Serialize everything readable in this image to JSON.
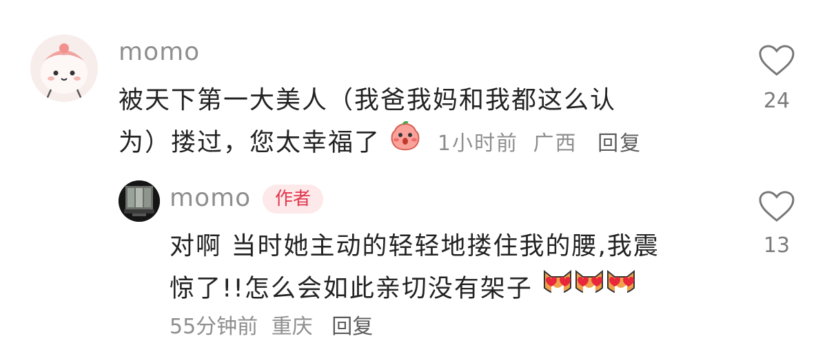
{
  "comment": {
    "username": "momo",
    "text_line1": "被天下第一大美人（我爸我妈和我都这么认",
    "text_line2": "为）搂过，您太幸福了",
    "time": "1小时前",
    "location": "广西",
    "reply_label": "回复",
    "like_count": "24"
  },
  "reply": {
    "username": "momo",
    "badge": "作者",
    "text_line1": "对啊 当时她主动的轻轻地搂住我的腰,我震",
    "text_line2": "惊了!!怎么会如此亲切没有架子",
    "time": "55分钟前",
    "location": "重庆",
    "reply_label": "回复",
    "like_count": "13"
  },
  "icons": {
    "like": "heart-outline-icon",
    "emoji_comment": "blushing-peach-emoji",
    "emoji_reply": "heart-eyes-dog-emoji"
  },
  "colors": {
    "badge_bg": "#fde8ea",
    "badge_text": "#e0364c",
    "meta_text": "#8e8e8e",
    "content_text": "#222222"
  }
}
